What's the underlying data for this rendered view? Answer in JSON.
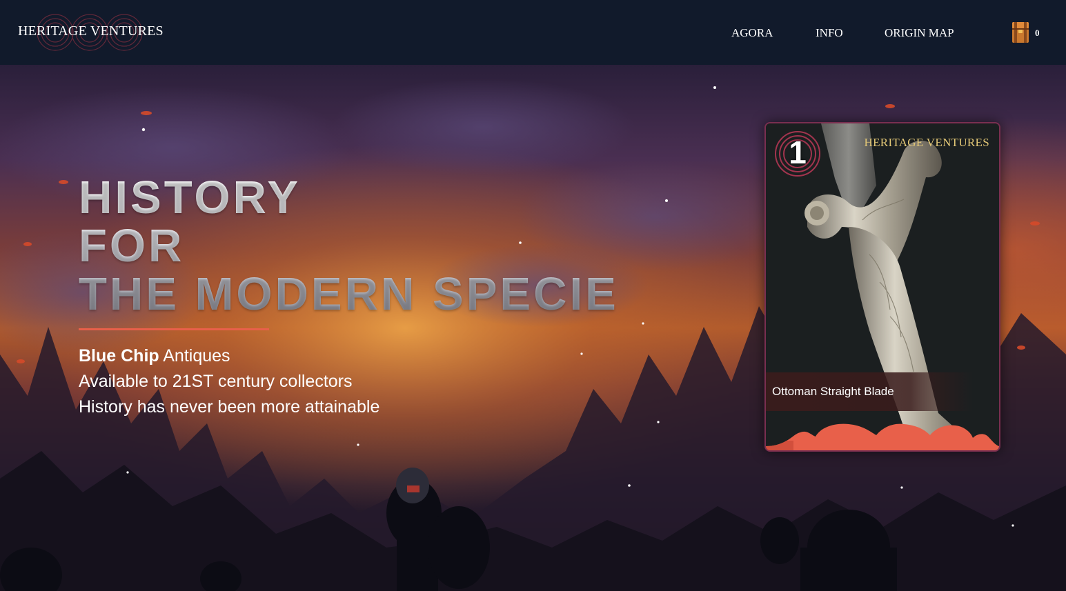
{
  "navbar": {
    "brand": "HERITAGE VENTURES",
    "links": [
      "AGORA",
      "INFO",
      "ORIGIN MAP"
    ],
    "cart_count": "0"
  },
  "hero": {
    "headline": [
      "HISTORY",
      "FOR",
      "THE MODERN SPECIE"
    ],
    "sub_bold": "Blue Chip",
    "sub_line1_rest": " Antiques",
    "sub_line2": "Available to 21ST century collectors",
    "sub_line3": "History has never been more attainable"
  },
  "card": {
    "rank": "1",
    "brand": "HERITAGE VENTURES",
    "item_name": "Ottoman Straight Blade"
  },
  "colors": {
    "navbar_bg": "#111a2b",
    "accent": "#e8604a",
    "card_border": "#7a2f50",
    "card_brand_gold": "#e3c877"
  }
}
